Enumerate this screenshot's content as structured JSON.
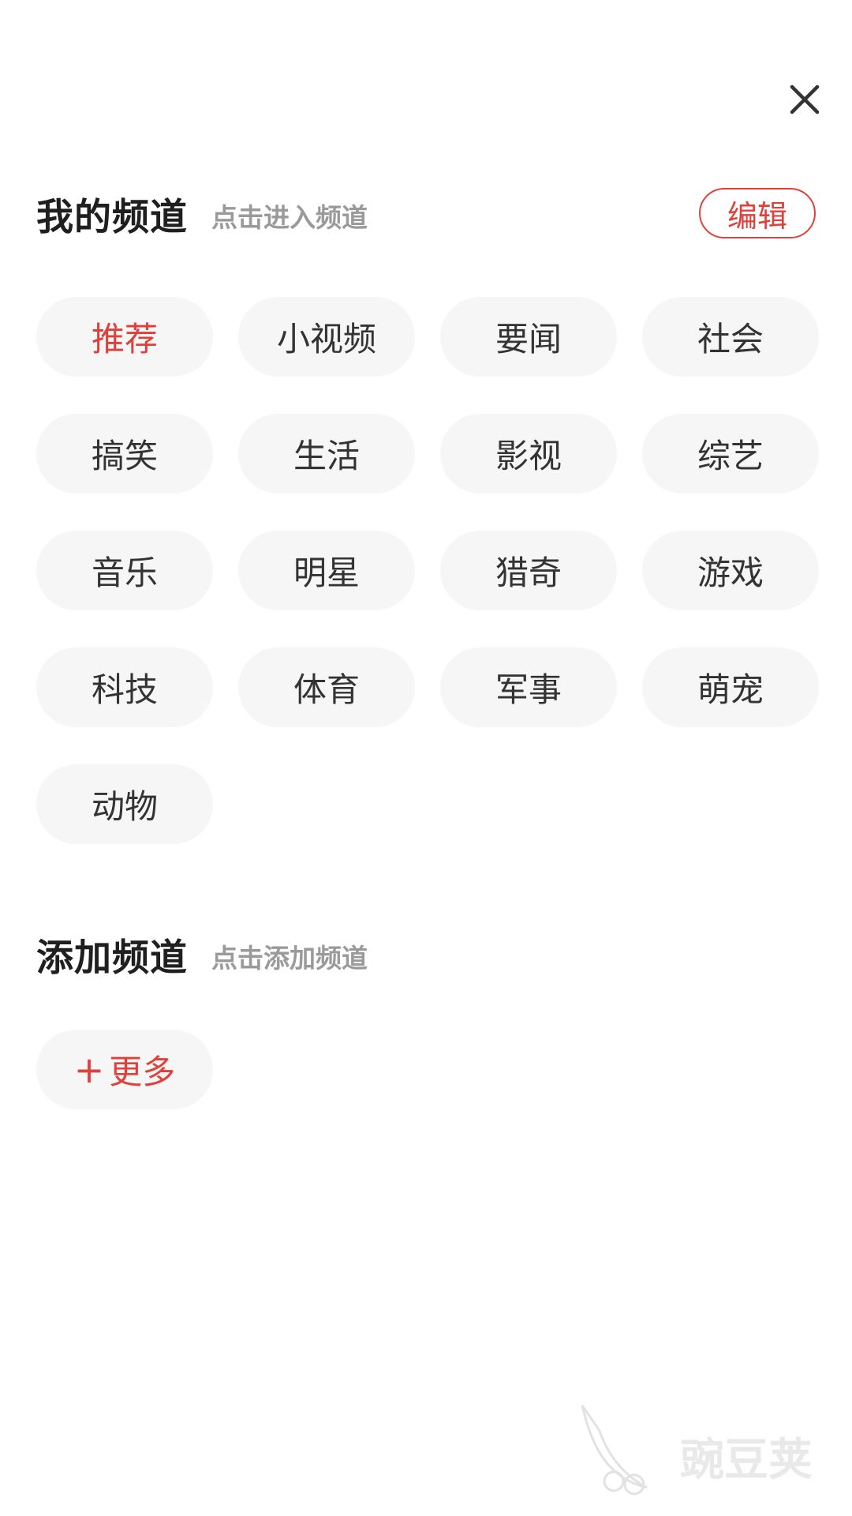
{
  "icons": {
    "close": "close-icon",
    "plus": "plus-icon",
    "watermark": "pea-logo-icon"
  },
  "my_channels": {
    "title": "我的频道",
    "subtitle": "点击进入频道",
    "edit_label": "编辑",
    "active_index": 0,
    "items": [
      {
        "label": "推荐"
      },
      {
        "label": "小视频"
      },
      {
        "label": "要闻"
      },
      {
        "label": "社会"
      },
      {
        "label": "搞笑"
      },
      {
        "label": "生活"
      },
      {
        "label": "影视"
      },
      {
        "label": "综艺"
      },
      {
        "label": "音乐"
      },
      {
        "label": "明星"
      },
      {
        "label": "猎奇"
      },
      {
        "label": "游戏"
      },
      {
        "label": "科技"
      },
      {
        "label": "体育"
      },
      {
        "label": "军事"
      },
      {
        "label": "萌宠"
      },
      {
        "label": "动物"
      }
    ]
  },
  "add_channels": {
    "title": "添加频道",
    "subtitle": "点击添加频道",
    "more_label": "更多",
    "plus_symbol": "+"
  },
  "watermark": {
    "text": "豌豆荚"
  },
  "colors": {
    "accent": "#e0403a",
    "chip_background": "#f6f6f6",
    "title_text": "#1f1f1f",
    "subtitle_text": "#9a9a9a"
  }
}
